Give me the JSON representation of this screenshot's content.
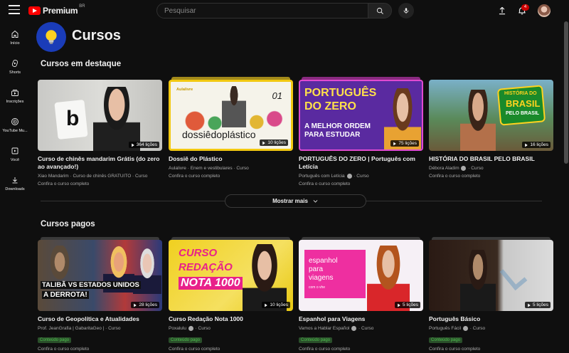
{
  "header": {
    "logo_text": "Premium",
    "logo_country": "BR",
    "search_placeholder": "Pesquisar",
    "notification_count": "4"
  },
  "sidebar": {
    "items": [
      {
        "label": "Início",
        "icon": "home-icon"
      },
      {
        "label": "Shorts",
        "icon": "shorts-icon"
      },
      {
        "label": "Inscrições",
        "icon": "subscriptions-icon"
      },
      {
        "label": "YouTube Mu...",
        "icon": "youtube-music-icon"
      },
      {
        "label": "Você",
        "icon": "you-icon"
      },
      {
        "label": "Downloads",
        "icon": "download-icon"
      }
    ]
  },
  "page": {
    "title": "Cursos"
  },
  "featured": {
    "title": "Cursos em destaque",
    "show_more": "Mostrar mais",
    "cards": [
      {
        "title": "Curso de chinês mandarim Grátis (do zero ao avançado!)",
        "meta": "Xiao Mandarim · Curso de chinês GRATUITO · Curso",
        "link": "Confira o curso completo",
        "lessons": "364 lições",
        "art": "b"
      },
      {
        "title": "Dossiê do Plástico",
        "meta": "Aulalivre · Enem e vestibulares · Curso",
        "link": "Confira o curso completo",
        "lessons": "10 lições",
        "art_main": "dossiêdoplástico",
        "art_num": "01",
        "art_brand": "Aulalivre"
      },
      {
        "title": "PORTUGUÊS DO ZERO | Português com Letícia",
        "channel": "Português com Letícia",
        "meta_suffix": "· Curso",
        "link": "Confira o curso completo",
        "lessons": "75 lições",
        "art_line1": "PORTUGUÊS",
        "art_line2": "DO ZERO",
        "art_line3": "A MELHOR ORDEM",
        "art_line4": "PARA ESTUDAR"
      },
      {
        "title": "HISTÓRIA DO BRASIL PELO BRASIL",
        "channel": "Débora Aladim",
        "meta_suffix": "· Curso",
        "link": "Confira o curso completo",
        "lessons": "16 lições",
        "art_line1": "HISTÓRIA DO",
        "art_line2": "BRASIL",
        "art_line3": "PELO BRASIL"
      }
    ]
  },
  "paid": {
    "title": "Cursos pagos",
    "cards": [
      {
        "title": "Curso de Geopolítica e Atualidades",
        "channel": "Prof. JeanGrafia | GabaritaGeo |",
        "meta_suffix": "· Curso",
        "paid_label": "Conteúdo pago",
        "link": "Confira o curso completo",
        "lessons": "28 lições",
        "art_line1": "TALIBÃ VS ESTADOS UNIDOS",
        "art_line2": "A DERROTA!"
      },
      {
        "title": "Curso Redação Nota 1000",
        "channel": "Poxalulu",
        "meta_suffix": "· Curso",
        "paid_label": "Conteúdo pago",
        "link": "Confira o curso completo",
        "lessons": "10 lições",
        "art_line1": "CURSO",
        "art_line2": "REDAÇÃO",
        "art_line3": "NOTA 1000"
      },
      {
        "title": "Espanhol para Viagens",
        "channel": "Vamos a Hablar Español",
        "meta_suffix": "· Curso",
        "paid_label": "Conteúdo pago",
        "link": "Confira o curso completo",
        "lessons": "5 lições",
        "art_line1": "espanhol",
        "art_line2": "para",
        "art_line3": "viagens",
        "art_line4": "com o vhe"
      },
      {
        "title": "Português Básico",
        "channel": "Português Fácil",
        "meta_suffix": "· Curso",
        "paid_label": "Conteúdo pago",
        "link": "Confira o curso completo",
        "lessons": "5 lições"
      }
    ]
  },
  "colors": {
    "background": "#0f0f0f",
    "accent_red": "#ff0000",
    "paid_green": "#4fc04f"
  }
}
